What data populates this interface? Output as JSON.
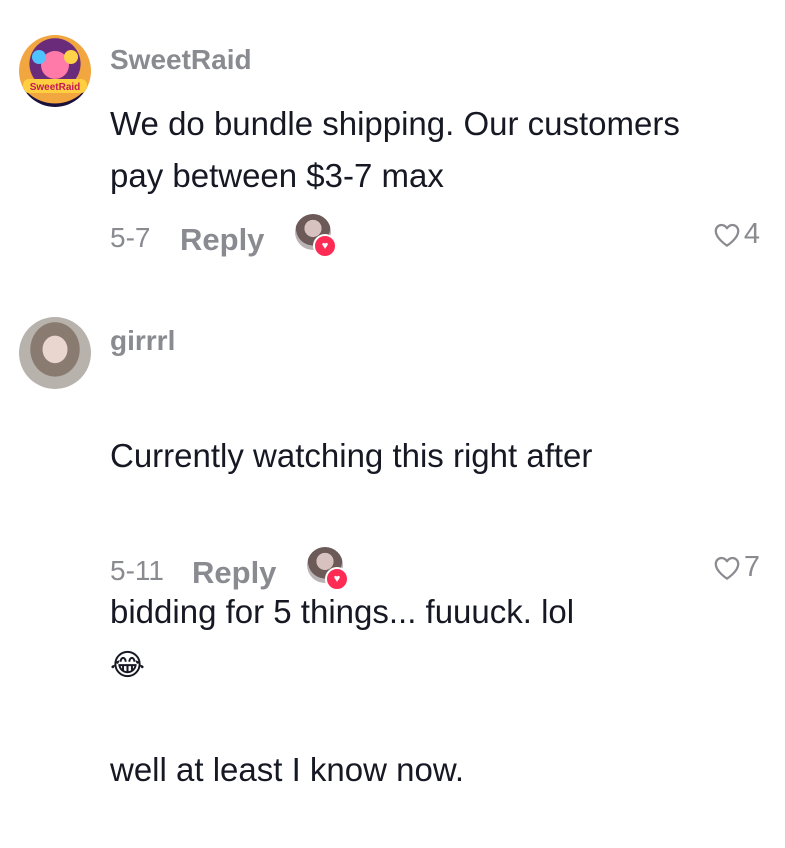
{
  "comments": [
    {
      "username": "SweetRaid",
      "avatar_text": "SweetRaid",
      "text": "We do bundle shipping. Our customers\npay between $3-7 max",
      "date": "5-7",
      "reply_label": "Reply",
      "likes": "4"
    },
    {
      "username": "girrrl",
      "text_line1": "Currently watching this right after",
      "text_line2": "bidding for 5 things... fuuuck. lol",
      "emoji": "😂",
      "text_line3": "well at least I know now.",
      "date": "5-11",
      "reply_label": "Reply",
      "likes": "7"
    }
  ],
  "colors": {
    "text": "#161823",
    "muted": "#8a8b91",
    "accent": "#fe2c55"
  }
}
